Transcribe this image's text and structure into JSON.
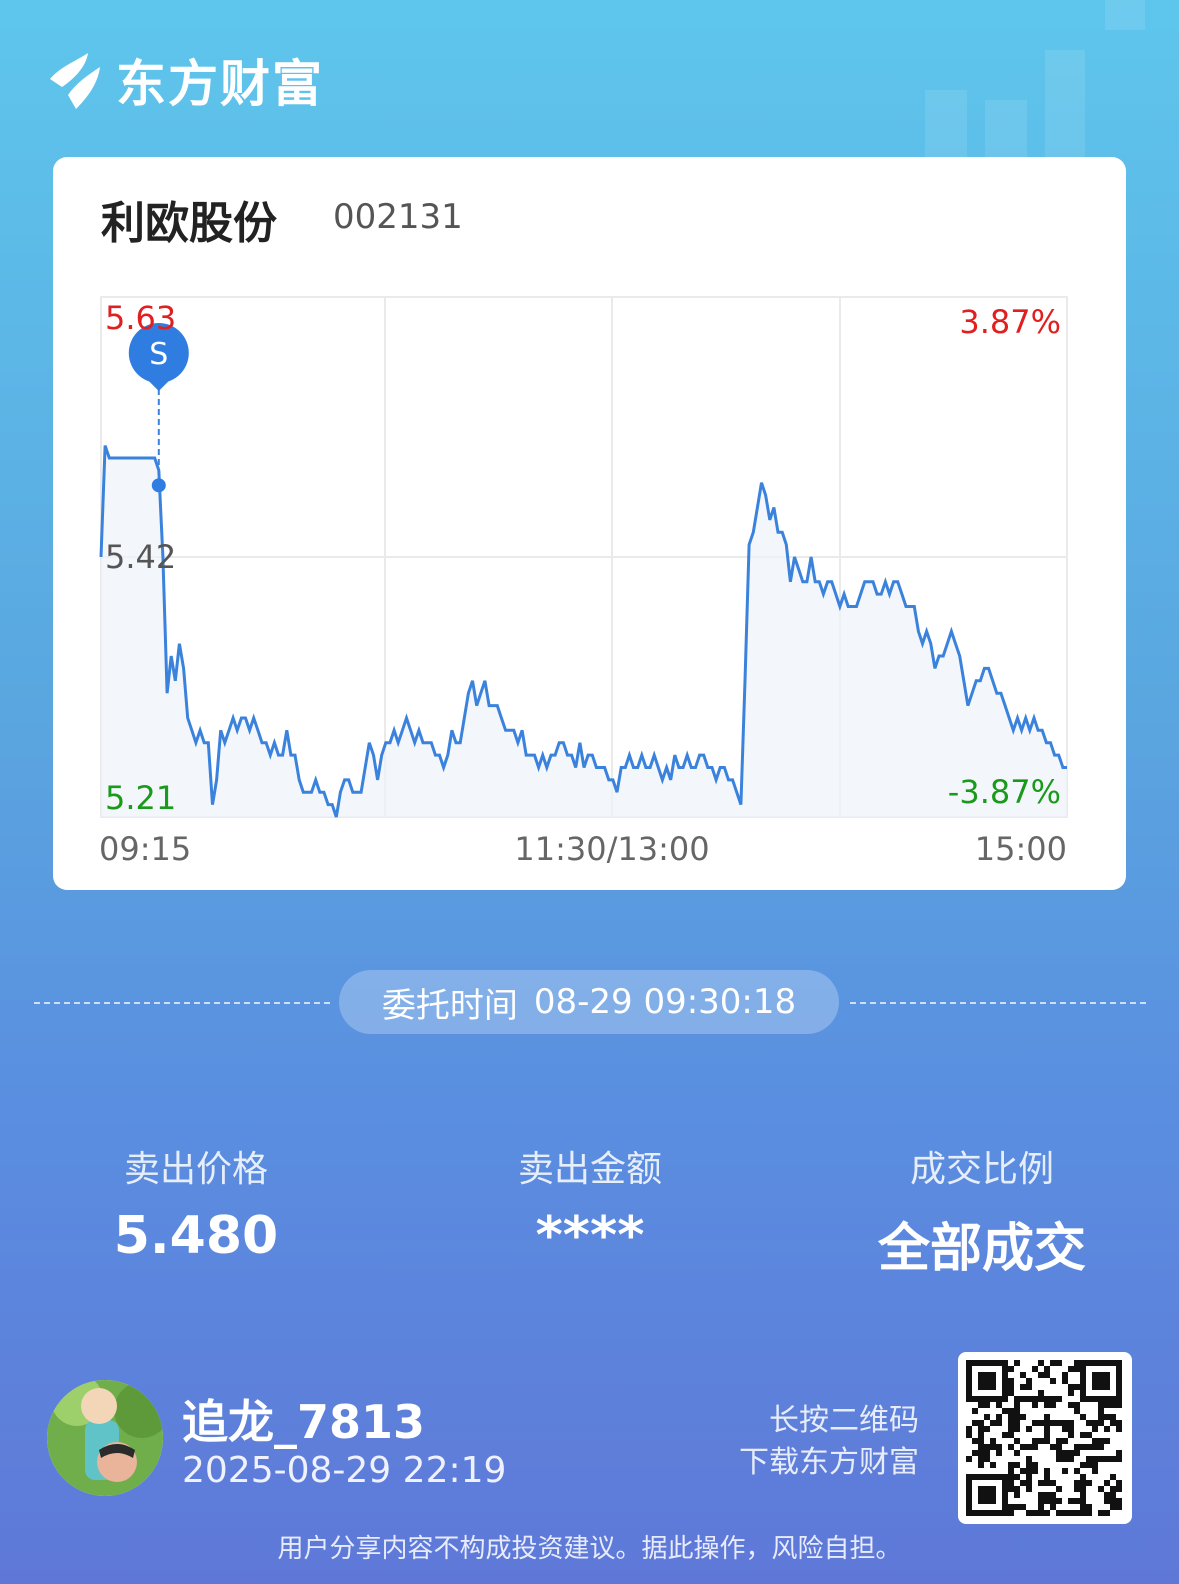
{
  "brand": {
    "name": "东方财富"
  },
  "stock": {
    "name": "利欧股份",
    "code": "002131"
  },
  "chart_data": {
    "type": "line",
    "title": "",
    "x_labels": [
      "09:15",
      "11:30/13:00",
      "15:00"
    ],
    "y_labels_left": [
      "5.63",
      "5.42",
      "5.21"
    ],
    "y_labels_right": [
      "3.87%",
      "-3.87%"
    ],
    "ylim": [
      5.21,
      5.63
    ],
    "grid": true,
    "x": [
      0,
      1,
      2,
      3,
      4,
      5,
      6,
      7,
      8,
      9,
      10,
      11,
      12,
      13,
      14,
      15,
      16,
      17,
      18,
      19,
      20,
      21,
      22,
      23,
      24,
      25,
      26,
      27,
      28,
      29,
      30,
      31,
      32,
      33,
      34,
      35,
      36,
      37,
      38,
      39,
      40,
      41,
      42,
      43,
      44,
      45,
      46,
      47,
      48,
      49,
      50,
      51,
      52,
      53,
      54,
      55,
      56,
      57,
      58,
      59,
      60,
      61,
      62,
      63,
      64,
      65,
      66,
      67,
      68,
      69,
      70,
      71,
      72,
      73,
      74,
      75,
      76,
      77,
      78,
      79,
      80,
      81,
      82,
      83,
      84,
      85,
      86,
      87,
      88,
      89,
      90,
      91,
      92,
      93,
      94,
      95,
      96,
      97,
      98,
      99,
      100,
      101,
      102,
      103,
      104,
      105,
      106,
      107,
      108,
      109,
      110,
      111,
      112,
      113,
      114,
      115,
      116,
      117,
      118,
      119,
      120,
      121,
      122,
      123,
      124,
      125,
      126,
      127,
      128,
      129,
      130,
      131,
      132,
      133,
      134,
      135,
      136,
      137,
      138,
      139,
      140,
      141,
      142,
      143,
      144,
      145,
      146,
      147,
      148,
      149,
      150,
      151,
      152,
      153,
      154,
      155,
      156,
      157,
      158,
      159,
      160,
      161,
      162,
      163,
      164,
      165,
      166,
      167,
      168,
      169,
      170,
      171,
      172,
      173,
      174,
      175,
      176,
      177,
      178,
      179,
      180,
      181,
      182,
      183,
      184,
      185,
      186,
      187,
      188,
      189,
      190,
      191,
      192,
      193,
      194,
      195,
      196,
      197,
      198,
      199,
      200,
      201,
      202,
      203,
      204,
      205,
      206,
      207,
      208,
      209,
      210,
      211,
      212,
      213,
      214,
      215,
      216,
      217,
      218,
      219,
      220,
      221,
      222,
      223,
      224,
      225,
      226,
      227,
      228,
      229,
      230,
      231,
      232,
      233,
      234,
      235,
      236,
      237,
      238,
      239,
      240
    ],
    "series": [
      {
        "values": [
          5.42,
          5.51,
          5.5,
          5.5,
          5.5,
          5.5,
          5.5,
          5.5,
          5.5,
          5.5,
          5.5,
          5.5,
          5.5,
          5.5,
          5.49,
          5.42,
          5.31,
          5.34,
          5.32,
          5.35,
          5.33,
          5.29,
          5.28,
          5.27,
          5.28,
          5.27,
          5.27,
          5.22,
          5.24,
          5.28,
          5.27,
          5.28,
          5.29,
          5.28,
          5.29,
          5.29,
          5.28,
          5.29,
          5.28,
          5.27,
          5.27,
          5.26,
          5.27,
          5.26,
          5.26,
          5.28,
          5.26,
          5.26,
          5.24,
          5.23,
          5.23,
          5.23,
          5.24,
          5.23,
          5.23,
          5.22,
          5.22,
          5.21,
          5.23,
          5.24,
          5.24,
          5.23,
          5.23,
          5.23,
          5.25,
          5.27,
          5.26,
          5.24,
          5.26,
          5.27,
          5.27,
          5.28,
          5.27,
          5.28,
          5.29,
          5.28,
          5.27,
          5.28,
          5.27,
          5.27,
          5.27,
          5.26,
          5.26,
          5.25,
          5.26,
          5.28,
          5.27,
          5.27,
          5.29,
          5.31,
          5.32,
          5.3,
          5.31,
          5.32,
          5.3,
          5.3,
          5.3,
          5.29,
          5.28,
          5.28,
          5.28,
          5.27,
          5.28,
          5.26,
          5.26,
          5.26,
          5.25,
          5.26,
          5.25,
          5.26,
          5.26,
          5.27,
          5.27,
          5.26,
          5.26,
          5.25,
          5.27,
          5.25,
          5.26,
          5.26,
          5.25,
          5.25,
          5.25,
          5.24,
          5.24,
          5.23,
          5.25,
          5.25,
          5.26,
          5.25,
          5.25,
          5.26,
          5.25,
          5.25,
          5.26,
          5.25,
          5.24,
          5.25,
          5.24,
          5.26,
          5.25,
          5.25,
          5.26,
          5.25,
          5.25,
          5.26,
          5.26,
          5.25,
          5.25,
          5.24,
          5.25,
          5.25,
          5.24,
          5.24,
          5.23,
          5.22,
          5.32,
          5.43,
          5.44,
          5.46,
          5.48,
          5.47,
          5.45,
          5.46,
          5.44,
          5.44,
          5.43,
          5.4,
          5.42,
          5.41,
          5.4,
          5.4,
          5.42,
          5.4,
          5.4,
          5.39,
          5.4,
          5.4,
          5.39,
          5.38,
          5.39,
          5.38,
          5.38,
          5.38,
          5.39,
          5.4,
          5.4,
          5.4,
          5.39,
          5.39,
          5.4,
          5.39,
          5.4,
          5.4,
          5.39,
          5.38,
          5.38,
          5.38,
          5.36,
          5.35,
          5.36,
          5.35,
          5.33,
          5.34,
          5.34,
          5.35,
          5.36,
          5.35,
          5.34,
          5.32,
          5.3,
          5.31,
          5.32,
          5.32,
          5.33,
          5.33,
          5.32,
          5.31,
          5.31,
          5.3,
          5.29,
          5.28,
          5.29,
          5.28,
          5.29,
          5.28,
          5.29,
          5.28,
          5.28,
          5.27,
          5.27,
          5.26,
          5.26,
          5.25,
          5.25
        ]
      }
    ],
    "marker": {
      "label": "S",
      "x_index": 14,
      "value": 5.49
    }
  },
  "order": {
    "time_label": "委托时间",
    "time_value": "08-29 09:30:18"
  },
  "stats": [
    {
      "label": "卖出价格",
      "value": "5.480"
    },
    {
      "label": "卖出金额",
      "value": "****"
    },
    {
      "label": "成交比例",
      "value": "全部成交"
    }
  ],
  "user": {
    "name": "追龙_7813",
    "datetime": "2025-08-29 22:19"
  },
  "qr": {
    "hint_line1": "长按二维码",
    "hint_line2": "下载东方财富"
  },
  "disclaimer": "用户分享内容不构成投资建议。据此操作，风险自担。",
  "colors": {
    "up": "#e02020",
    "down": "#1a9a1a",
    "line": "#3a82dc",
    "marker": "#2f7de0"
  }
}
